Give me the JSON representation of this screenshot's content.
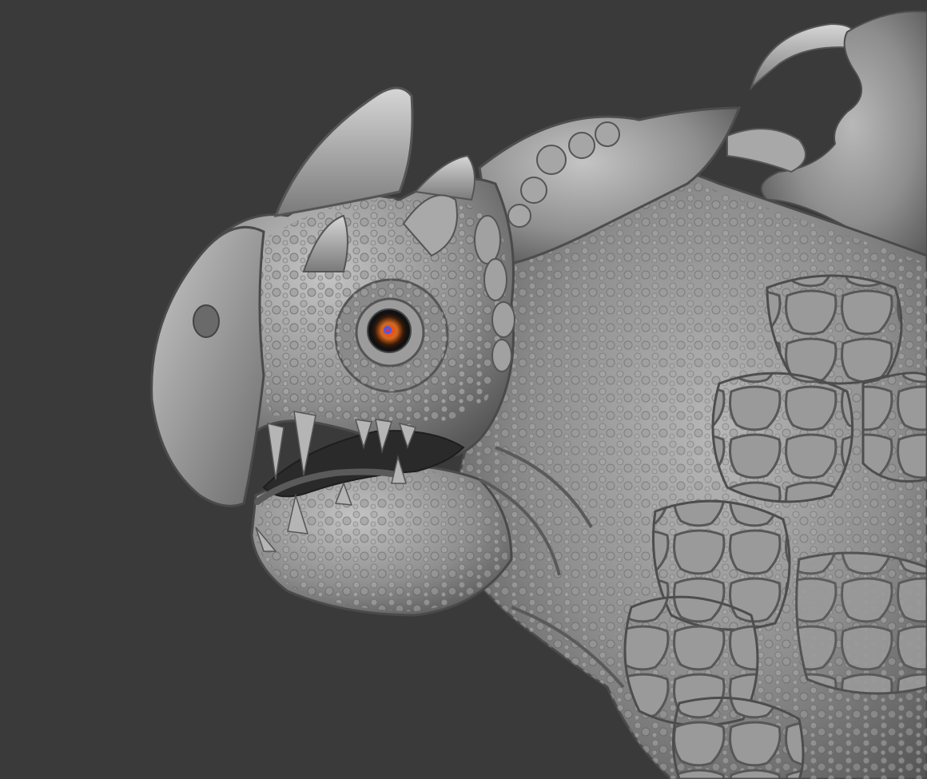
{
  "scene": {
    "background_color": "#3a3a3a",
    "material_color": "#8f8f8f",
    "shadow_color": "#4a4a4a",
    "highlight_color": "#c9c9c9",
    "eye_color": "#d2691e",
    "eye_core_color": "#3a0000",
    "pupil_highlight_color": "#3a5cff",
    "icons": [
      "creature-sculpt",
      "horn",
      "claw",
      "eye",
      "teeth"
    ]
  }
}
